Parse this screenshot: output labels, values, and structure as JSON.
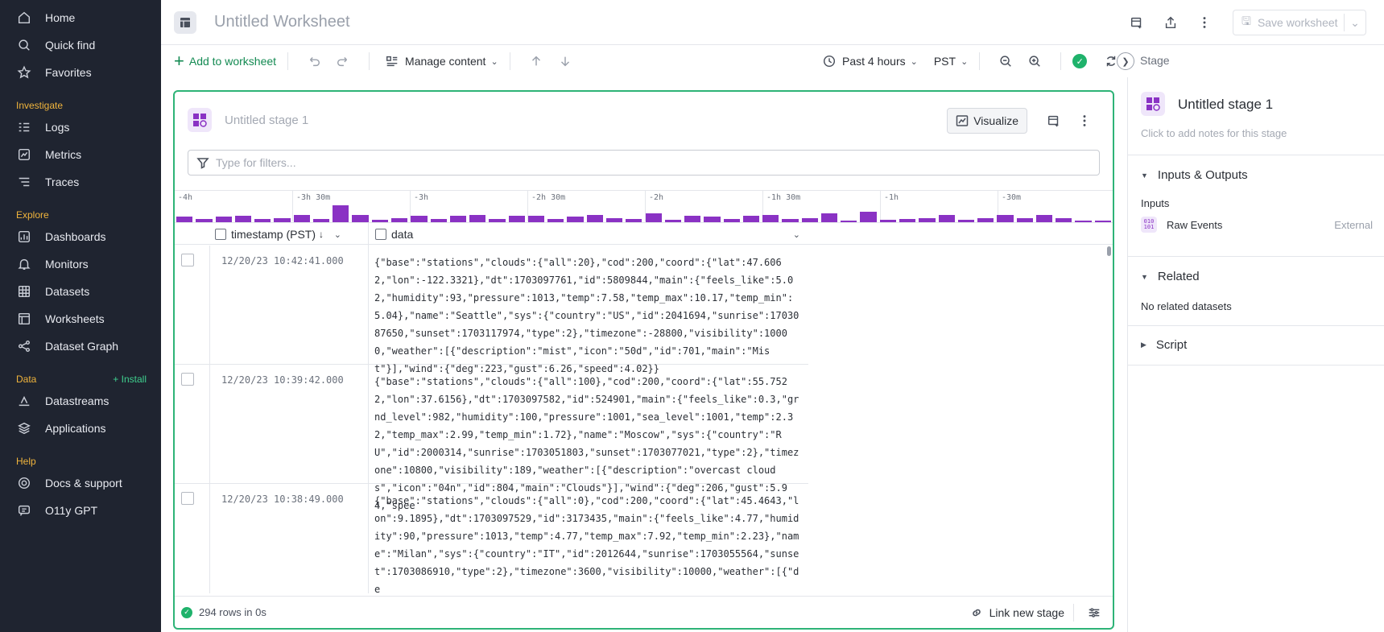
{
  "sidebar": {
    "top_items": [
      {
        "label": "Home",
        "icon": "home-icon"
      },
      {
        "label": "Quick find",
        "icon": "search-icon"
      },
      {
        "label": "Favorites",
        "icon": "star-icon"
      }
    ],
    "sections": [
      {
        "title": "Investigate",
        "items": [
          {
            "label": "Logs",
            "icon": "logs-icon"
          },
          {
            "label": "Metrics",
            "icon": "metrics-icon"
          },
          {
            "label": "Traces",
            "icon": "traces-icon"
          }
        ]
      },
      {
        "title": "Explore",
        "items": [
          {
            "label": "Dashboards",
            "icon": "dashboard-icon"
          },
          {
            "label": "Monitors",
            "icon": "bell-icon"
          },
          {
            "label": "Datasets",
            "icon": "grid-icon"
          },
          {
            "label": "Worksheets",
            "icon": "worksheet-icon"
          },
          {
            "label": "Dataset Graph",
            "icon": "graph-icon"
          }
        ]
      },
      {
        "title": "Data",
        "action": "+ Install",
        "items": [
          {
            "label": "Datastreams",
            "icon": "datastream-icon"
          },
          {
            "label": "Applications",
            "icon": "layers-icon"
          }
        ]
      },
      {
        "title": "Help",
        "items": [
          {
            "label": "Docs & support",
            "icon": "docs-icon"
          },
          {
            "label": "O11y GPT",
            "icon": "chat-icon"
          }
        ]
      }
    ]
  },
  "header": {
    "title": "Untitled Worksheet",
    "save_label": "Save worksheet"
  },
  "toolbar": {
    "add_label": "Add to worksheet",
    "manage_label": "Manage content",
    "time_range": "Past 4 hours",
    "timezone": "PST",
    "stage_label": "Stage"
  },
  "stage": {
    "name": "Untitled stage 1",
    "visualize_label": "Visualize",
    "filter_placeholder": "Type for filters...",
    "histogram": {
      "ticks": [
        "-4h",
        "-3h 30m",
        "-3h",
        "-2h 30m",
        "-2h",
        "-1h 30m",
        "-1h",
        "-30m"
      ],
      "bars": [
        0.18,
        0.1,
        0.18,
        0.22,
        0.1,
        0.14,
        0.25,
        0.1,
        0.55,
        0.25,
        0.08,
        0.14,
        0.2,
        0.1,
        0.2,
        0.25,
        0.1,
        0.2,
        0.2,
        0.1,
        0.18,
        0.25,
        0.12,
        0.1,
        0.3,
        0.08,
        0.2,
        0.18,
        0.1,
        0.2,
        0.25,
        0.1,
        0.12,
        0.3,
        0.06,
        0.35,
        0.08,
        0.1,
        0.14,
        0.25,
        0.08,
        0.14,
        0.25,
        0.14,
        0.25,
        0.12,
        0.06,
        0.04
      ]
    },
    "columns": {
      "timestamp": "timestamp (PST)",
      "data": "data"
    },
    "rows": [
      {
        "timestamp": "12/20/23 10:42:41.000",
        "data": "{\"base\":\"stations\",\"clouds\":{\"all\":20},\"cod\":200,\"coord\":{\"lat\":47.6062,\"lon\":-122.3321},\"dt\":1703097761,\"id\":5809844,\"main\":{\"feels_like\":5.02,\"humidity\":93,\"pressure\":1013,\"temp\":7.58,\"temp_max\":10.17,\"temp_min\":5.04},\"name\":\"Seattle\",\"sys\":{\"country\":\"US\",\"id\":2041694,\"sunrise\":1703087650,\"sunset\":1703117974,\"type\":2},\"timezone\":-28800,\"visibility\":10000,\"weather\":[{\"description\":\"mist\",\"icon\":\"50d\",\"id\":701,\"main\":\"Mist\"}],\"wind\":{\"deg\":223,\"gust\":6.26,\"speed\":4.02}}"
      },
      {
        "timestamp": "12/20/23 10:39:42.000",
        "data": "{\"base\":\"stations\",\"clouds\":{\"all\":100},\"cod\":200,\"coord\":{\"lat\":55.7522,\"lon\":37.6156},\"dt\":1703097582,\"id\":524901,\"main\":{\"feels_like\":0.3,\"grnd_level\":982,\"humidity\":100,\"pressure\":1001,\"sea_level\":1001,\"temp\":2.32,\"temp_max\":2.99,\"temp_min\":1.72},\"name\":\"Moscow\",\"sys\":{\"country\":\"RU\",\"id\":2000314,\"sunrise\":1703051803,\"sunset\":1703077021,\"type\":2},\"timezone\":10800,\"visibility\":189,\"weather\":[{\"description\":\"overcast clouds\",\"icon\":\"04n\",\"id\":804,\"main\":\"Clouds\"}],\"wind\":{\"deg\":206,\"gust\":5.94,\"spee"
      },
      {
        "timestamp": "12/20/23 10:38:49.000",
        "data": "{\"base\":\"stations\",\"clouds\":{\"all\":0},\"cod\":200,\"coord\":{\"lat\":45.4643,\"lon\":9.1895},\"dt\":1703097529,\"id\":3173435,\"main\":{\"feels_like\":4.77,\"humidity\":90,\"pressure\":1013,\"temp\":4.77,\"temp_max\":7.92,\"temp_min\":2.23},\"name\":\"Milan\",\"sys\":{\"country\":\"IT\",\"id\":2012644,\"sunrise\":1703055564,\"sunset\":1703086910,\"type\":2},\"timezone\":3600,\"visibility\":10000,\"weather\":[{\"de"
      }
    ],
    "footer_status": "294 rows in 0s",
    "link_label": "Link new stage"
  },
  "right_panel": {
    "title": "Untitled stage 1",
    "notes_placeholder": "Click to add notes for this stage",
    "io_title": "Inputs & Outputs",
    "inputs_label": "Inputs",
    "input_name": "Raw Events",
    "input_type": "External",
    "related_title": "Related",
    "related_empty": "No related datasets",
    "script_title": "Script"
  },
  "colors": {
    "accent": "#138a52",
    "stage_border": "#2eb377",
    "histogram": "#8a32c4",
    "sidebar_bg": "#1f2430",
    "section_title": "#f0b43c"
  }
}
